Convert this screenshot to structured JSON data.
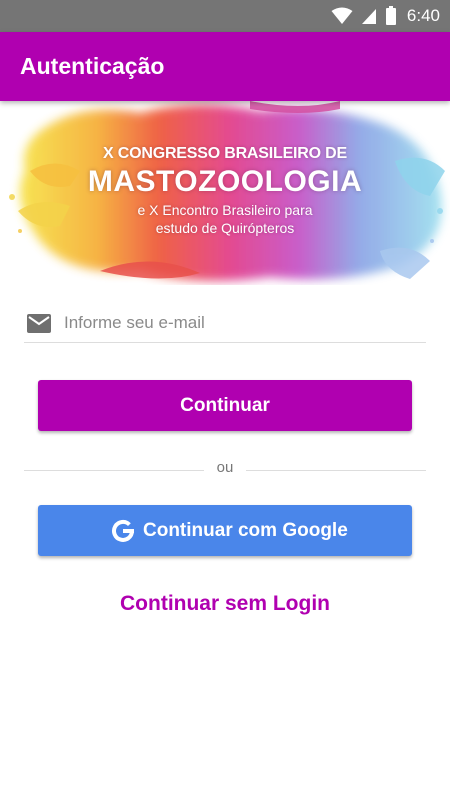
{
  "status_bar": {
    "time": "6:40",
    "icons": [
      "wifi-icon",
      "signal-icon",
      "battery-icon"
    ]
  },
  "app_bar": {
    "title": "Autenticação"
  },
  "banner": {
    "line1": "X CONGRESSO BRASILEIRO DE",
    "line2": "MASTOZOOLOGIA",
    "line3": "e X Encontro Brasileiro para",
    "line4": "estudo de Quirópteros"
  },
  "login": {
    "email_placeholder": "Informe seu e-mail",
    "email_value": "",
    "email_icon": "mail-icon",
    "continue_label": "Continuar",
    "divider_label": "ou",
    "google_label": "Continuar com Google",
    "google_icon": "google-g-icon",
    "no_login_label": "Continuar sem Login"
  },
  "colors": {
    "primary": "#b000b0",
    "google_blue": "#4a86ea",
    "status_bar": "#757575"
  }
}
